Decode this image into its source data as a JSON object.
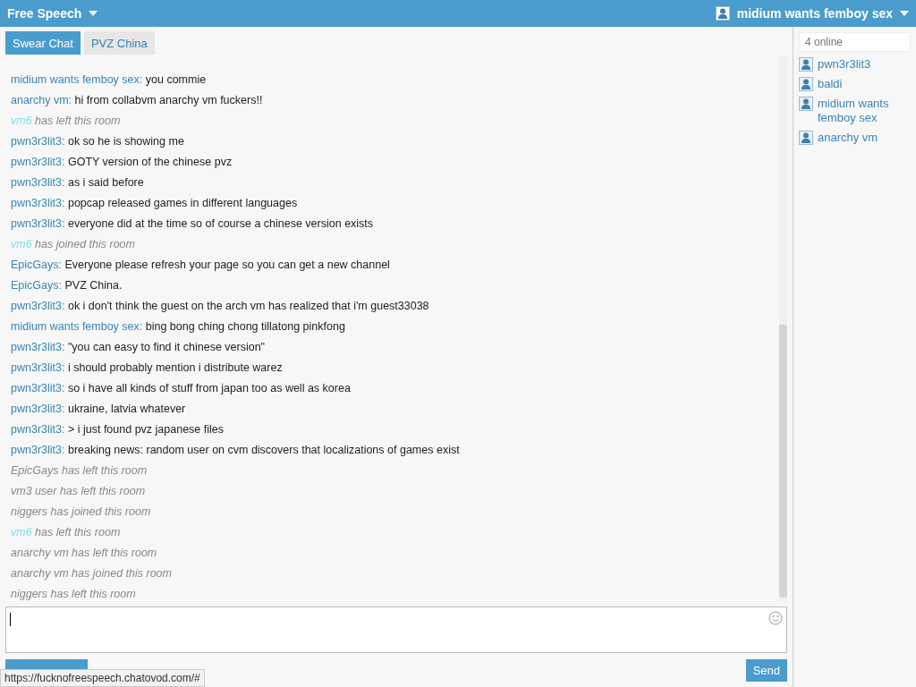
{
  "header": {
    "site": "Free Speech",
    "user": "midium wants femboy sex"
  },
  "tabs": [
    {
      "label": "Swear Chat",
      "selected": true
    },
    {
      "label": "PVZ China",
      "selected": false
    }
  ],
  "messages": [
    {
      "kind": "message",
      "nick": "midium wants femboy sex:",
      "text": "you commie"
    },
    {
      "kind": "message",
      "nick": "anarchy vm:",
      "text": "hi from collabvm anarchy vm fuckers!!"
    },
    {
      "kind": "event",
      "nick": "vm6",
      "color": "#7fe0ec",
      "text": "has left this room"
    },
    {
      "kind": "message",
      "nick": "pwn3r3lit3:",
      "text": "ok so he is showing me"
    },
    {
      "kind": "message",
      "nick": "pwn3r3lit3:",
      "text": "GOTY version of the chinese pvz"
    },
    {
      "kind": "message",
      "nick": "pwn3r3lit3:",
      "text": "as i said before"
    },
    {
      "kind": "message",
      "nick": "pwn3r3lit3:",
      "text": "popcap released games in different languages"
    },
    {
      "kind": "message",
      "nick": "pwn3r3lit3:",
      "text": "everyone did at the time so of course a chinese version exists"
    },
    {
      "kind": "event",
      "nick": "vm6",
      "color": "#7fe0ec",
      "text": "has joined this room"
    },
    {
      "kind": "message",
      "nick": "EpicGays:",
      "text": "Everyone please refresh your page so you can get a new channel"
    },
    {
      "kind": "message",
      "nick": "EpicGays:",
      "text": "PVZ China."
    },
    {
      "kind": "message",
      "nick": "pwn3r3lit3:",
      "text": "ok i don't think the guest on the arch vm has realized that i'm guest33038"
    },
    {
      "kind": "message",
      "nick": "midium wants femboy sex:",
      "text": "bing bong ching chong tillatong pinkfong"
    },
    {
      "kind": "message",
      "nick": "pwn3r3lit3:",
      "text": "\"you can easy to find it chinese version\""
    },
    {
      "kind": "message",
      "nick": "pwn3r3lit3:",
      "text": "i should probably mention i distribute warez"
    },
    {
      "kind": "message",
      "nick": "pwn3r3lit3:",
      "text": "so i have all kinds of stuff from japan too as well as korea"
    },
    {
      "kind": "message",
      "nick": "pwn3r3lit3:",
      "text": "ukraine, latvia whatever"
    },
    {
      "kind": "message",
      "nick": "pwn3r3lit3:",
      "text": "> i just found pvz japanese files"
    },
    {
      "kind": "message",
      "nick": "pwn3r3lit3:",
      "text": "breaking news: random user on cvm discovers that localizations of games exist"
    },
    {
      "kind": "event",
      "nick": "EpicGays",
      "color": "#888888",
      "text": "has left this room"
    },
    {
      "kind": "event",
      "nick": "vm3 user",
      "color": "#888888",
      "text": "has left this room"
    },
    {
      "kind": "event",
      "nick": "niggers",
      "color": "#888888",
      "text": "has joined this room"
    },
    {
      "kind": "event",
      "nick": "vm6",
      "color": "#7fe0ec",
      "text": "has left this room"
    },
    {
      "kind": "event",
      "nick": "anarchy vm",
      "color": "#888888",
      "text": "has left this room"
    },
    {
      "kind": "event",
      "nick": "anarchy vm",
      "color": "#888888",
      "text": "has joined this room"
    },
    {
      "kind": "event",
      "nick": "niggers",
      "color": "#888888",
      "text": "has left this room"
    }
  ],
  "send_button": "Send",
  "status_url": "https://fucknofreespeech.chatovod.com/#",
  "online": {
    "placeholder": "4 online",
    "users": [
      "pwn3r3lit3",
      "baldi",
      "midium wants femboy sex",
      "anarchy vm"
    ]
  }
}
